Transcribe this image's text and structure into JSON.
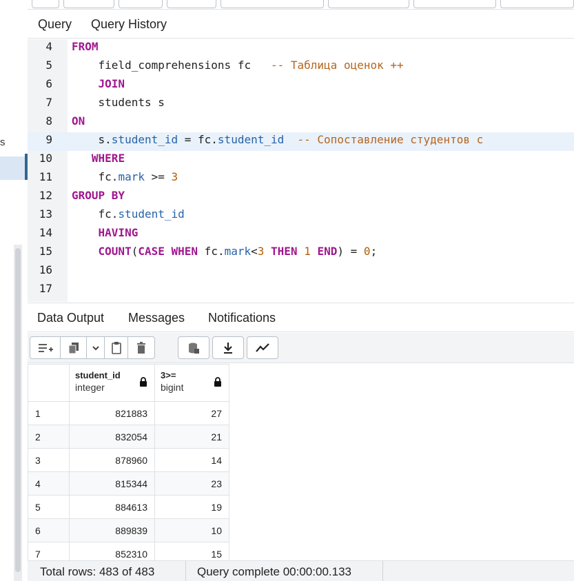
{
  "left_panel": {
    "partial_letter": "s"
  },
  "query_tabs": [
    {
      "label": "Query",
      "active": true
    },
    {
      "label": "Query History",
      "active": false
    }
  ],
  "editor": {
    "lines": [
      {
        "n": "4",
        "html": "<span class=\"kw\">FROM</span>"
      },
      {
        "n": "5",
        "html": "    field_comprehensions fc   <span class=\"cm\">-- Таблица оценок ++</span>"
      },
      {
        "n": "6",
        "html": "    <span class=\"kw\">JOIN</span>"
      },
      {
        "n": "7",
        "html": "    students s"
      },
      {
        "n": "8",
        "html": "<span class=\"kw\">ON</span>"
      },
      {
        "n": "9",
        "html": "    s.<span class=\"col\">student_id</span> = fc.<span class=\"col\">student_id</span>  <span class=\"cm\">-- Сопоставление студентов с</span>",
        "active": true
      },
      {
        "n": "10",
        "html": "   <span class=\"kw\">WHERE</span>"
      },
      {
        "n": "11",
        "html": "    fc.<span class=\"col\">mark</span> &gt;= <span class=\"num\">3</span>"
      },
      {
        "n": "12",
        "html": "<span class=\"kw\">GROUP BY</span>"
      },
      {
        "n": "13",
        "html": "    fc.<span class=\"col\">student_id</span>"
      },
      {
        "n": "14",
        "html": "    <span class=\"kw\">HAVING</span>"
      },
      {
        "n": "15",
        "html": "    <span class=\"fn\">COUNT</span>(<span class=\"kw\">CASE WHEN</span> fc.<span class=\"col\">mark</span>&lt;<span class=\"num\">3</span> <span class=\"kw\">THEN</span> <span class=\"num\">1</span> <span class=\"kw\">END</span>) = <span class=\"num\">0</span>;"
      },
      {
        "n": "16",
        "html": ""
      },
      {
        "n": "17",
        "html": ""
      }
    ]
  },
  "result_tabs": [
    {
      "label": "Data Output",
      "active": true
    },
    {
      "label": "Messages",
      "active": false
    },
    {
      "label": "Notifications",
      "active": false
    }
  ],
  "grid": {
    "columns": [
      {
        "name": "student_id",
        "type": "integer"
      },
      {
        "name": "3>=",
        "type": "bigint"
      }
    ],
    "rows": [
      {
        "n": "1",
        "student_id": "821883",
        "count": "27"
      },
      {
        "n": "2",
        "student_id": "832054",
        "count": "21"
      },
      {
        "n": "3",
        "student_id": "878960",
        "count": "14"
      },
      {
        "n": "4",
        "student_id": "815344",
        "count": "23"
      },
      {
        "n": "5",
        "student_id": "884613",
        "count": "19"
      },
      {
        "n": "6",
        "student_id": "889839",
        "count": "10"
      },
      {
        "n": "7",
        "student_id": "852310",
        "count": "15"
      }
    ]
  },
  "status": {
    "total_rows": "Total rows: 483 of 483",
    "query_complete": "Query complete 00:00:00.133"
  },
  "colors": {
    "keyword": "#a0178e",
    "comment": "#b5651d",
    "column": "#2563a8",
    "number": "#b35c00",
    "accent": "#326690"
  }
}
